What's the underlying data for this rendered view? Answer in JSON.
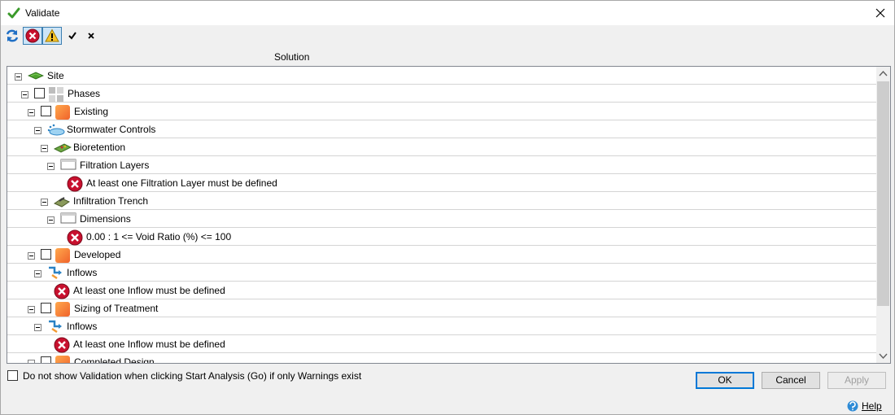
{
  "window": {
    "title": "Validate"
  },
  "toolbar": {
    "items": [
      {
        "name": "refresh-icon"
      },
      {
        "name": "show-errors-toggle",
        "icon": "error-icon",
        "pressed": true
      },
      {
        "name": "show-warnings-toggle",
        "icon": "warning-icon",
        "pressed": true
      },
      {
        "name": "check-all-button",
        "icon": "checkmark-icon"
      },
      {
        "name": "uncheck-all-button",
        "icon": "cross-icon"
      }
    ]
  },
  "column_header": "Solution",
  "tree": {
    "rows": [
      {
        "label": "Site",
        "icon": "site-icon",
        "level": 0,
        "expander": true,
        "checkbox": false
      },
      {
        "label": "Phases",
        "icon": "phases-icon",
        "level": 1,
        "expander": true,
        "checkbox": true
      },
      {
        "label": "Existing",
        "icon": "phase-icon",
        "level": 2,
        "expander": true,
        "checkbox": true
      },
      {
        "label": "Stormwater Controls",
        "icon": "stormwater-icon",
        "level": 3,
        "expander": true,
        "checkbox": false
      },
      {
        "label": "Bioretention",
        "icon": "bioretention-icon",
        "level": 4,
        "expander": true,
        "checkbox": false
      },
      {
        "label": "Filtration Layers",
        "icon": "table-icon",
        "level": 5,
        "expander": true,
        "checkbox": false
      },
      {
        "label": "At least one Filtration Layer must be defined",
        "icon": "error-icon",
        "level": 6,
        "expander": false,
        "checkbox": false
      },
      {
        "label": "Infiltration Trench",
        "icon": "trench-icon",
        "level": 4,
        "expander": true,
        "checkbox": false
      },
      {
        "label": "Dimensions",
        "icon": "table-icon",
        "level": 5,
        "expander": true,
        "checkbox": false
      },
      {
        "label": "0.00 : 1 <= Void Ratio (%) <= 100",
        "icon": "error-icon",
        "level": 6,
        "expander": false,
        "checkbox": false
      },
      {
        "label": "Developed",
        "icon": "phase-icon",
        "level": 2,
        "expander": true,
        "checkbox": true
      },
      {
        "label": "Inflows",
        "icon": "inflows-icon",
        "level": 3,
        "expander": true,
        "checkbox": false
      },
      {
        "label": "At least one Inflow must be defined",
        "icon": "error-icon",
        "level": 4,
        "expander": false,
        "checkbox": false
      },
      {
        "label": "Sizing of Treatment",
        "icon": "phase-icon",
        "level": 2,
        "expander": true,
        "checkbox": true
      },
      {
        "label": "Inflows",
        "icon": "inflows-icon",
        "level": 3,
        "expander": true,
        "checkbox": false
      },
      {
        "label": "At least one Inflow must be defined",
        "icon": "error-icon",
        "level": 4,
        "expander": false,
        "checkbox": false
      },
      {
        "label": "Completed Design",
        "icon": "phase-icon",
        "level": 2,
        "expander": true,
        "checkbox": true
      }
    ]
  },
  "footer": {
    "checkbox_label": "Do not show Validation when clicking Start Analysis (Go) if only Warnings exist",
    "ok_label": "OK",
    "cancel_label": "Cancel",
    "apply_label": "Apply",
    "help_label": "Help"
  }
}
